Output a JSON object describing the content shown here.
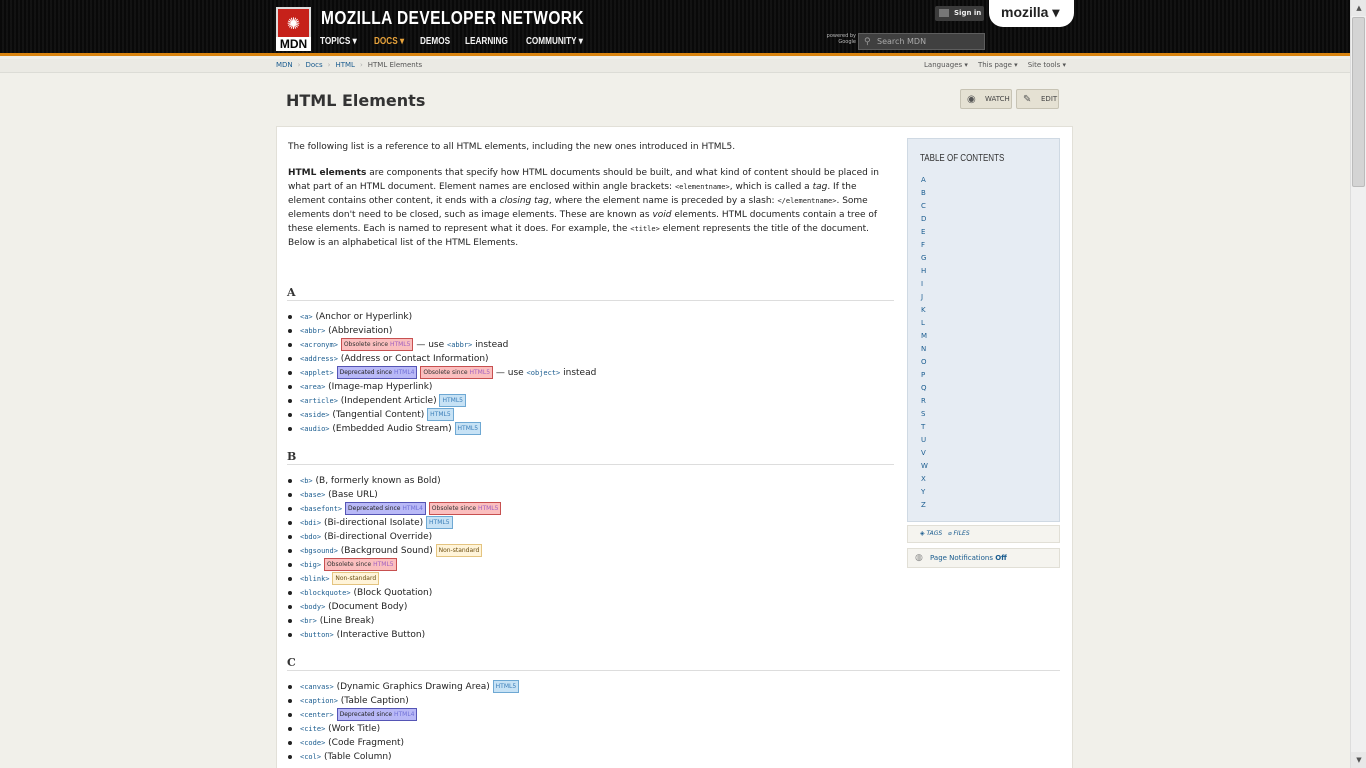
{
  "header": {
    "logo_text": "MDN",
    "site_title": "MOZILLA DEVELOPER NETWORK",
    "nav": [
      "TOPICS ▾",
      "DOCS ▾",
      "DEMOS",
      "LEARNING",
      "COMMUNITY ▾"
    ],
    "powered_by": "powered by Google",
    "search_placeholder": "Search MDN",
    "sign_in": "Sign in",
    "mozilla": "mozilla ▾",
    "accent": "#d98410"
  },
  "breadcrumb": [
    "MDN",
    "Docs",
    "HTML",
    "HTML Elements"
  ],
  "page_tools": [
    "Languages ▾",
    "This page ▾",
    "Site tools ▾"
  ],
  "page": {
    "title": "HTML Elements",
    "watch": "WATCH",
    "edit": "EDIT"
  },
  "intro": {
    "p1": "The following list is a reference to all HTML elements, including the new ones introduced in HTML5.",
    "p2_strong": "HTML elements",
    "p2_a": " are components that specify how HTML documents should be built, and what kind of content should be placed in what part of an HTML document. Element names are enclosed within angle brackets: ",
    "p2_code1": "<elementname>",
    "p2_b": ", which is called a ",
    "p2_em1": "tag",
    "p2_c": ". If the element contains other content, it ends with a ",
    "p2_em2": "closing tag",
    "p2_d": ", where the element name is preceded by a slash: ",
    "p2_code2": "</elementname>",
    "p2_e": ". Some elements don't need to be closed, such as image elements. These are known as ",
    "p2_em3": "void",
    "p2_f": " elements. HTML documents contain a tree of these elements. Each is named to represent what it does. For example, the ",
    "p2_code3": "<title>",
    "p2_g": " element represents the title of the document. Below is an alphabetical list of the HTML Elements."
  },
  "sections": {
    "A": {
      "heading": "A",
      "items": [
        {
          "tag": "<a>",
          "desc": " (Anchor or Hyperlink)",
          "badges": []
        },
        {
          "tag": "<abbr>",
          "desc": " (Abbreviation)",
          "badges": []
        },
        {
          "tag": "<acronym>",
          "desc": "",
          "badges": [
            {
              "kind": "obs",
              "text": "Obsolete since ",
              "ver": "HTML5"
            }
          ],
          "after": " — use ",
          "after_tag": "<abbr>",
          "after2": " instead"
        },
        {
          "tag": "<address>",
          "desc": " (Address or Contact Information)",
          "badges": []
        },
        {
          "tag": "<applet>",
          "desc": "",
          "badges": [
            {
              "kind": "dep",
              "text": "Deprecated since ",
              "ver": "HTML4"
            },
            {
              "kind": "obs",
              "text": "Obsolete since ",
              "ver": "HTML5"
            }
          ],
          "after": " — use ",
          "after_tag": "<object>",
          "after2": " instead"
        },
        {
          "tag": "<area>",
          "desc": " (Image-map Hyperlink)",
          "badges": []
        },
        {
          "tag": "<article>",
          "desc": " (Independent Article)",
          "badges": [
            {
              "kind": "h5",
              "text": "HTML5",
              "ver": ""
            }
          ]
        },
        {
          "tag": "<aside>",
          "desc": " (Tangential Content)",
          "badges": [
            {
              "kind": "h5",
              "text": "HTML5",
              "ver": ""
            }
          ]
        },
        {
          "tag": "<audio>",
          "desc": " (Embedded Audio Stream)",
          "badges": [
            {
              "kind": "h5",
              "text": "HTML5",
              "ver": ""
            }
          ]
        }
      ]
    },
    "B": {
      "heading": "B",
      "items": [
        {
          "tag": "<b>",
          "desc": " (B, formerly known as Bold)",
          "badges": []
        },
        {
          "tag": "<base>",
          "desc": " (Base URL)",
          "badges": []
        },
        {
          "tag": "<basefont>",
          "desc": "",
          "badges": [
            {
              "kind": "dep",
              "text": "Deprecated since ",
              "ver": "HTML4"
            },
            {
              "kind": "obs",
              "text": "Obsolete since ",
              "ver": "HTML5"
            }
          ]
        },
        {
          "tag": "<bdi>",
          "desc": " (Bi-directional Isolate)",
          "badges": [
            {
              "kind": "h5",
              "text": "HTML5",
              "ver": ""
            }
          ]
        },
        {
          "tag": "<bdo>",
          "desc": " (Bi-directional Override)",
          "badges": []
        },
        {
          "tag": "<bgsound>",
          "desc": " (Background Sound)",
          "badges": [
            {
              "kind": "ns",
              "text": "Non-standard",
              "ver": ""
            }
          ]
        },
        {
          "tag": "<big>",
          "desc": "",
          "badges": [
            {
              "kind": "obs",
              "text": "Obsolete since ",
              "ver": "HTML5"
            }
          ]
        },
        {
          "tag": "<blink>",
          "desc": "",
          "badges": [
            {
              "kind": "ns",
              "text": "Non-standard",
              "ver": ""
            }
          ]
        },
        {
          "tag": "<blockquote>",
          "desc": " (Block Quotation)",
          "badges": []
        },
        {
          "tag": "<body>",
          "desc": " (Document Body)",
          "badges": []
        },
        {
          "tag": "<br>",
          "desc": " (Line Break)",
          "badges": []
        },
        {
          "tag": "<button>",
          "desc": " (Interactive Button)",
          "badges": []
        }
      ]
    },
    "C": {
      "heading": "C",
      "items": [
        {
          "tag": "<canvas>",
          "desc": " (Dynamic Graphics Drawing Area)",
          "badges": [
            {
              "kind": "h5",
              "text": "HTML5",
              "ver": ""
            }
          ]
        },
        {
          "tag": "<caption>",
          "desc": " (Table Caption)",
          "badges": []
        },
        {
          "tag": "<center>",
          "desc": "",
          "badges": [
            {
              "kind": "dep",
              "text": "Deprecated since ",
              "ver": "HTML4"
            }
          ]
        },
        {
          "tag": "<cite>",
          "desc": " (Work Title)",
          "badges": []
        },
        {
          "tag": "<code>",
          "desc": " (Code Fragment)",
          "badges": []
        },
        {
          "tag": "<col>",
          "desc": " (Table Column)",
          "badges": []
        }
      ]
    }
  },
  "toc": {
    "title": "Table of Contents",
    "letters": [
      "A",
      "B",
      "C",
      "D",
      "E",
      "F",
      "G",
      "H",
      "I",
      "J",
      "K",
      "L",
      "M",
      "N",
      "O",
      "P",
      "Q",
      "R",
      "S",
      "T",
      "U",
      "V",
      "W",
      "X",
      "Y",
      "Z"
    ]
  },
  "sidebar": {
    "tags": "TAGS",
    "files": "FILES",
    "notifications_label": "Page Notifications ",
    "notifications_state": "Off"
  },
  "colors": {
    "obsolete_bg": "#fbbfbf",
    "deprecated_bg": "#b9b9f7",
    "html5_bg": "#c7e2f5",
    "nonstandard_bg": "#fff4d9"
  }
}
